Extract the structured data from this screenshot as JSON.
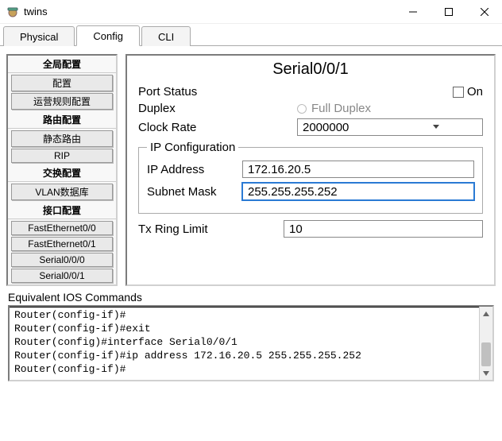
{
  "window": {
    "title": "twins"
  },
  "tabs": {
    "physical": "Physical",
    "config": "Config",
    "cli": "CLI"
  },
  "sidebar": {
    "groups": [
      {
        "header": "全局配置",
        "items": [
          "配置",
          "运营规则配置"
        ]
      },
      {
        "header": "路由配置",
        "items": [
          "静态路由",
          "RIP"
        ]
      },
      {
        "header": "交换配置",
        "items": [
          "VLAN数据库"
        ]
      },
      {
        "header": "接口配置",
        "items": [
          "FastEthernet0/0",
          "FastEthernet0/1",
          "Serial0/0/0",
          "Serial0/0/1"
        ]
      }
    ]
  },
  "panel": {
    "title": "Serial0/0/1",
    "port_status_label": "Port Status",
    "on_label": "On",
    "duplex_label": "Duplex",
    "full_duplex_label": "Full Duplex",
    "clock_rate_label": "Clock Rate",
    "clock_rate_value": "2000000",
    "ip_config_legend": "IP Configuration",
    "ip_addr_label": "IP Address",
    "ip_addr_value": "172.16.20.5",
    "subnet_label": "Subnet Mask",
    "subnet_value": "255.255.255.252",
    "tx_label": "Tx Ring Limit",
    "tx_value": "10"
  },
  "commands": {
    "heading": "Equivalent IOS Commands",
    "lines": "Router(config-if)#\nRouter(config-if)#exit\nRouter(config)#interface Serial0/0/1\nRouter(config-if)#ip address 172.16.20.5 255.255.255.252\nRouter(config-if)#"
  }
}
